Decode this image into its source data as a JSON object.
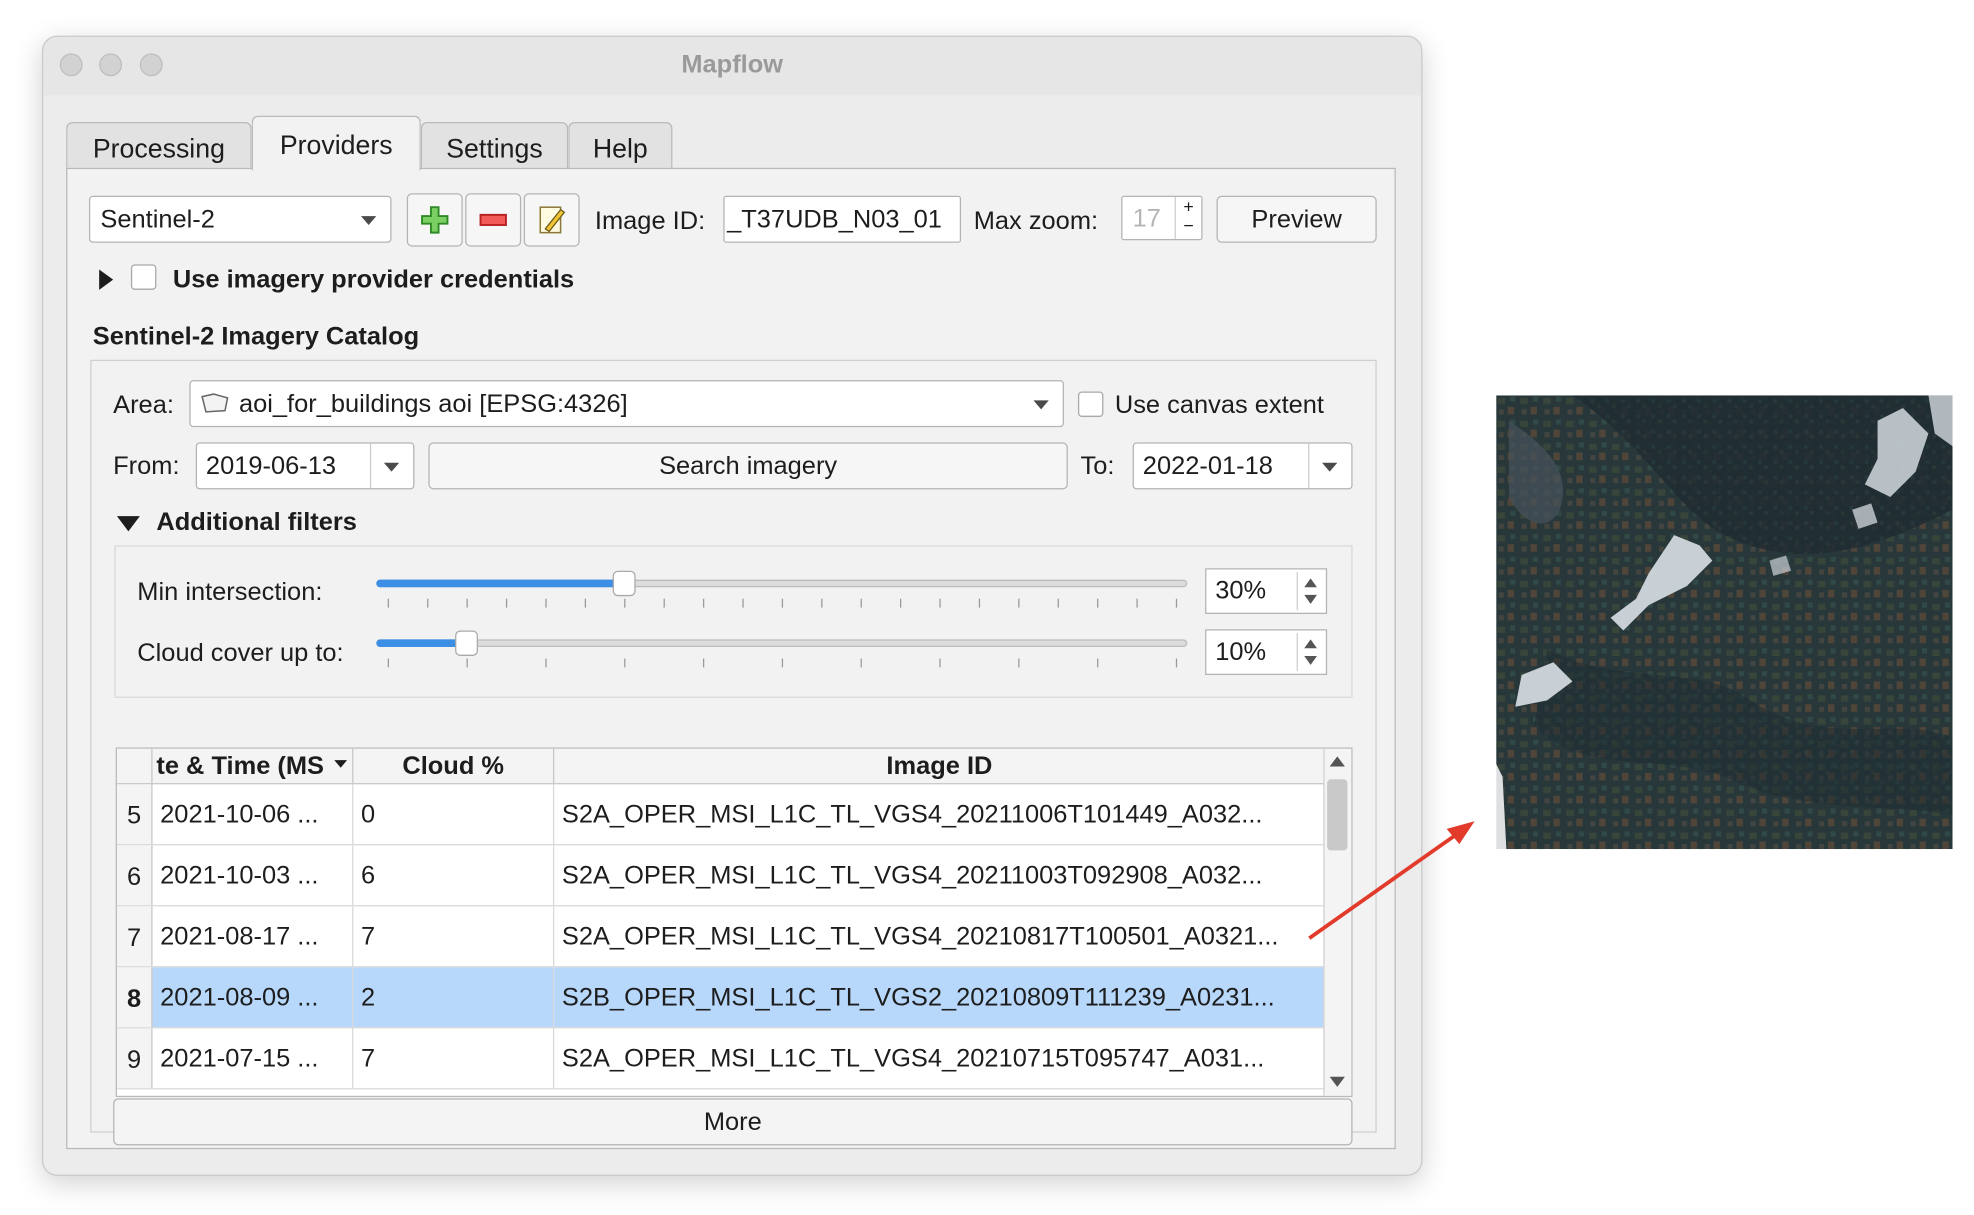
{
  "window": {
    "title": "Mapflow"
  },
  "tabs": [
    "Processing",
    "Providers",
    "Settings",
    "Help"
  ],
  "active_tab": "Providers",
  "provider": {
    "selected": "Sentinel-2",
    "image_id_label": "Image ID:",
    "image_id_value": "_T37UDB_N03_01",
    "max_zoom_label": "Max zoom:",
    "max_zoom_value": "17",
    "preview_label": "Preview",
    "credentials_label": "Use imagery provider credentials"
  },
  "catalog": {
    "title": "Sentinel-2 Imagery Catalog",
    "area_label": "Area:",
    "area_value": "aoi_for_buildings aoi [EPSG:4326]",
    "canvas_extent_label": "Use canvas extent",
    "from_label": "From:",
    "from_value": "2019-06-13",
    "search_label": "Search imagery",
    "to_label": "To:",
    "to_value": "2022-01-18",
    "filters_label": "Additional filters",
    "min_intersection_label": "Min intersection:",
    "min_intersection_value": "30%",
    "min_intersection_fraction": 0.3,
    "cloud_label": "Cloud cover up to:",
    "cloud_value": "10%",
    "cloud_fraction": 0.1
  },
  "table": {
    "headers": [
      "te & Time (MS",
      "Cloud %",
      "Image ID"
    ],
    "rows": [
      {
        "num": "5",
        "datetime": "2021-10-06 ...",
        "cloud": "0",
        "image_id": "S2A_OPER_MSI_L1C_TL_VGS4_20211006T101449_A032..."
      },
      {
        "num": "6",
        "datetime": "2021-10-03 ...",
        "cloud": "6",
        "image_id": "S2A_OPER_MSI_L1C_TL_VGS4_20211003T092908_A032..."
      },
      {
        "num": "7",
        "datetime": "2021-08-17 ...",
        "cloud": "7",
        "image_id": "S2A_OPER_MSI_L1C_TL_VGS4_20210817T100501_A0321..."
      },
      {
        "num": "8",
        "datetime": "2021-08-09 ...",
        "cloud": "2",
        "image_id": "S2B_OPER_MSI_L1C_TL_VGS2_20210809T111239_A0231..."
      },
      {
        "num": "9",
        "datetime": "2021-07-15 ...",
        "cloud": "7",
        "image_id": "S2A_OPER_MSI_L1C_TL_VGS4_20210715T095747_A031..."
      }
    ],
    "selected_row": "8",
    "more_label": "More"
  },
  "colors": {
    "selection": "#b7d7fb",
    "slider_accent": "#3d8fe5",
    "arrow": "#e23b2c"
  }
}
